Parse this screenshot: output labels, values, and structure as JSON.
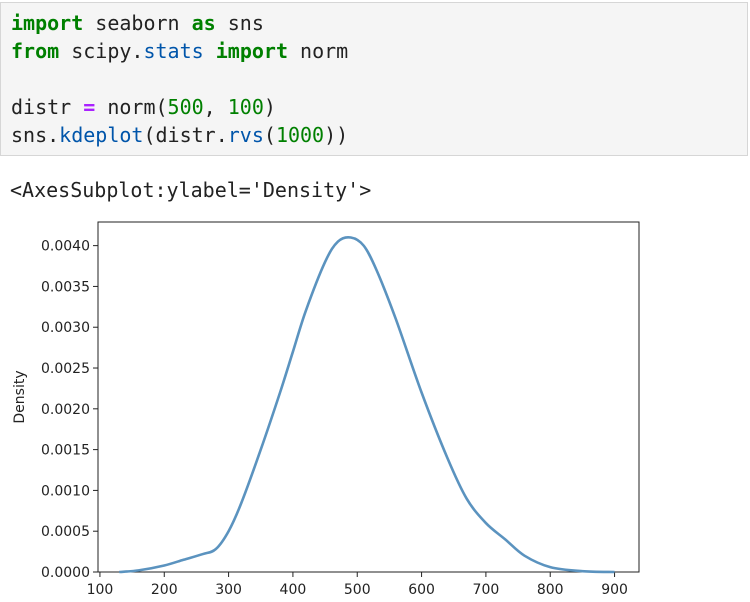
{
  "code_cell": {
    "lines": [
      {
        "tokens": [
          {
            "t": "import",
            "c": "kw"
          },
          {
            "t": " seaborn ",
            "c": ""
          },
          {
            "t": "as",
            "c": "kw"
          },
          {
            "t": " sns",
            "c": ""
          }
        ]
      },
      {
        "tokens": [
          {
            "t": "from",
            "c": "kw"
          },
          {
            "t": " scipy.",
            "c": ""
          },
          {
            "t": "stats",
            "c": "fn"
          },
          {
            "t": " ",
            "c": ""
          },
          {
            "t": "import",
            "c": "kw"
          },
          {
            "t": " norm",
            "c": ""
          }
        ]
      },
      {
        "tokens": []
      },
      {
        "tokens": [
          {
            "t": "distr ",
            "c": ""
          },
          {
            "t": "=",
            "c": "op"
          },
          {
            "t": " norm(",
            "c": ""
          },
          {
            "t": "500",
            "c": "num"
          },
          {
            "t": ", ",
            "c": ""
          },
          {
            "t": "100",
            "c": "num"
          },
          {
            "t": ")",
            "c": ""
          }
        ]
      },
      {
        "tokens": [
          {
            "t": "sns.",
            "c": ""
          },
          {
            "t": "kdeplot",
            "c": "fn"
          },
          {
            "t": "(distr.",
            "c": ""
          },
          {
            "t": "rvs",
            "c": "fn"
          },
          {
            "t": "(",
            "c": ""
          },
          {
            "t": "1000",
            "c": "num"
          },
          {
            "t": "))",
            "c": ""
          }
        ]
      }
    ]
  },
  "output": {
    "repr_text": "<AxesSubplot:ylabel='Density'>"
  },
  "colors": {
    "line": "#5b93bf",
    "axis": "#222222"
  },
  "chart_data": {
    "type": "line",
    "ylabel": "Density",
    "xlim": [
      97,
      938
    ],
    "ylim": [
      0,
      0.00402
    ],
    "x_ticks": [
      100,
      200,
      300,
      400,
      500,
      600,
      700,
      800,
      900
    ],
    "y_ticks": [
      0.0,
      0.0005,
      0.001,
      0.0015,
      0.002,
      0.0025,
      0.003,
      0.0035,
      0.004
    ],
    "x_tick_labels": [
      "100",
      "200",
      "300",
      "400",
      "500",
      "600",
      "700",
      "800",
      "900"
    ],
    "y_tick_labels": [
      "0.0000",
      "0.0005",
      "0.0010",
      "0.0015",
      "0.0020",
      "0.0025",
      "0.0030",
      "0.0035",
      "0.0040"
    ],
    "series": [
      {
        "x": [
          130,
          160,
          200,
          230,
          260,
          280,
          300,
          320,
          350,
          380,
          400,
          420,
          450,
          470,
          490,
          510,
          530,
          560,
          600,
          640,
          670,
          700,
          730,
          760,
          800,
          850,
          900
        ],
        "y": [
          0.0,
          2e-05,
          8e-05,
          0.00015,
          0.00022,
          0.00028,
          0.0005,
          0.00085,
          0.0015,
          0.0022,
          0.0027,
          0.0032,
          0.0038,
          0.00405,
          0.0041,
          0.004,
          0.0037,
          0.0031,
          0.0022,
          0.0014,
          0.0009,
          0.0006,
          0.0004,
          0.0002,
          6e-05,
          1e-05,
          0.0
        ]
      }
    ]
  }
}
